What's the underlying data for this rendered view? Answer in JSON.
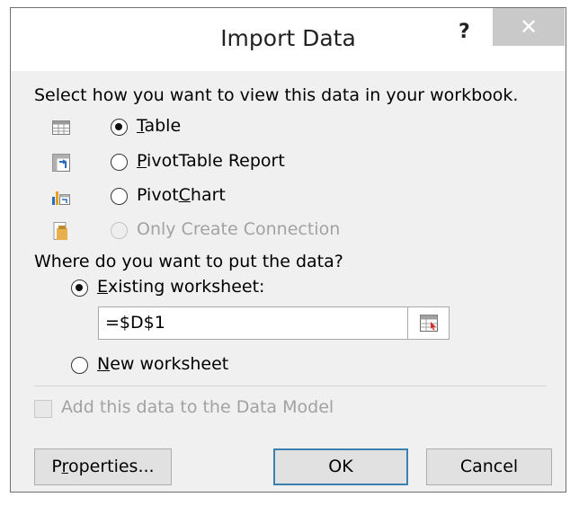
{
  "dialog": {
    "title": "Import Data",
    "help_label": "?",
    "close_label": "✕"
  },
  "view_section": {
    "prompt": "Select how you want to view this data in your workbook.",
    "options": [
      {
        "pre": "",
        "key": "T",
        "post": "able",
        "selected": true,
        "enabled": true,
        "icon": "table-icon"
      },
      {
        "pre": "",
        "key": "P",
        "post": "ivotTable Report",
        "selected": false,
        "enabled": true,
        "icon": "pivottable-icon"
      },
      {
        "pre": "Pivot",
        "key": "C",
        "post": "hart",
        "selected": false,
        "enabled": true,
        "icon": "pivotchart-icon"
      },
      {
        "pre": "",
        "key": "",
        "post": "Only Create Connection",
        "selected": false,
        "enabled": false,
        "icon": "connection-icon"
      }
    ]
  },
  "location_section": {
    "prompt": "Where do you want to put the data?",
    "existing": {
      "pre": "",
      "key": "E",
      "post": "xisting worksheet:",
      "selected": true
    },
    "range_value": "=$D$1",
    "new": {
      "pre": "",
      "key": "N",
      "post": "ew worksheet",
      "selected": false
    }
  },
  "data_model": {
    "label": "Add this data to the Data Model",
    "checked": false,
    "enabled": false
  },
  "buttons": {
    "properties": {
      "pre": "P",
      "key": "r",
      "post": "operties..."
    },
    "ok": "OK",
    "cancel": "Cancel"
  },
  "colors": {
    "accent": "#3c7fb1",
    "dialog_bg": "#f0f0f0",
    "disabled_text": "#a2a2a2",
    "close_bg": "#c9c9c9"
  }
}
